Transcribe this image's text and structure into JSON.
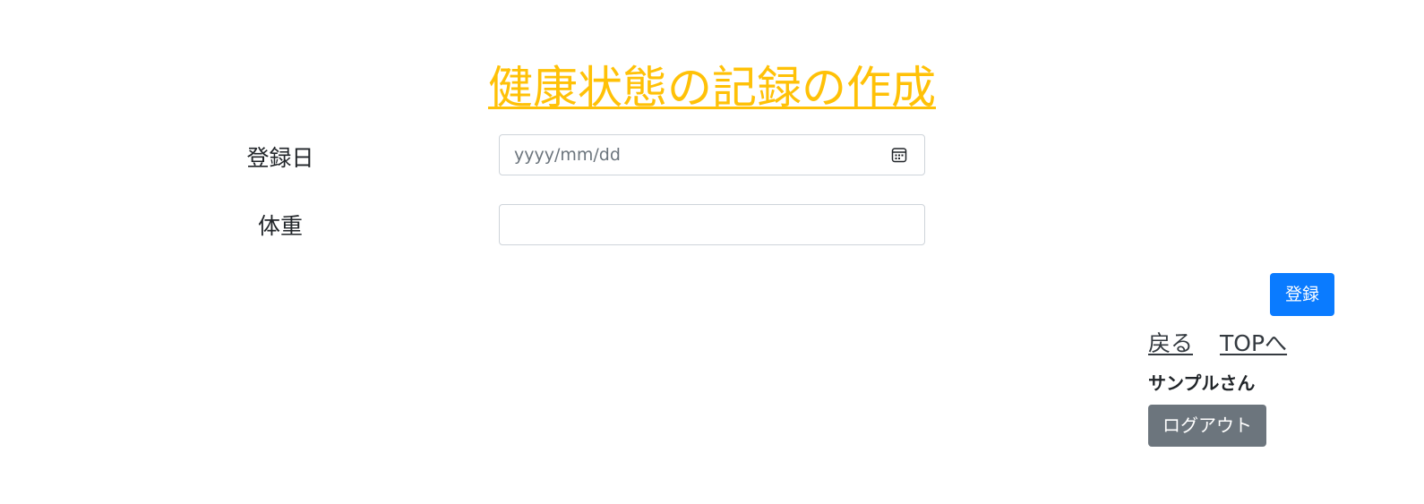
{
  "header": {
    "title": "健康状態の記録の作成"
  },
  "form": {
    "date_label": "登録日",
    "date_placeholder": "yyyy/mm/dd",
    "weight_label": "体重",
    "weight_value": "",
    "submit_label": "登録"
  },
  "nav": {
    "back_label": "戻る",
    "top_label": "TOPへ"
  },
  "user": {
    "name": "サンプルさん",
    "logout_label": "ログアウト"
  },
  "colors": {
    "title": "#ffc107",
    "primary_button": "#0a7bff",
    "secondary_button": "#6c757d"
  }
}
